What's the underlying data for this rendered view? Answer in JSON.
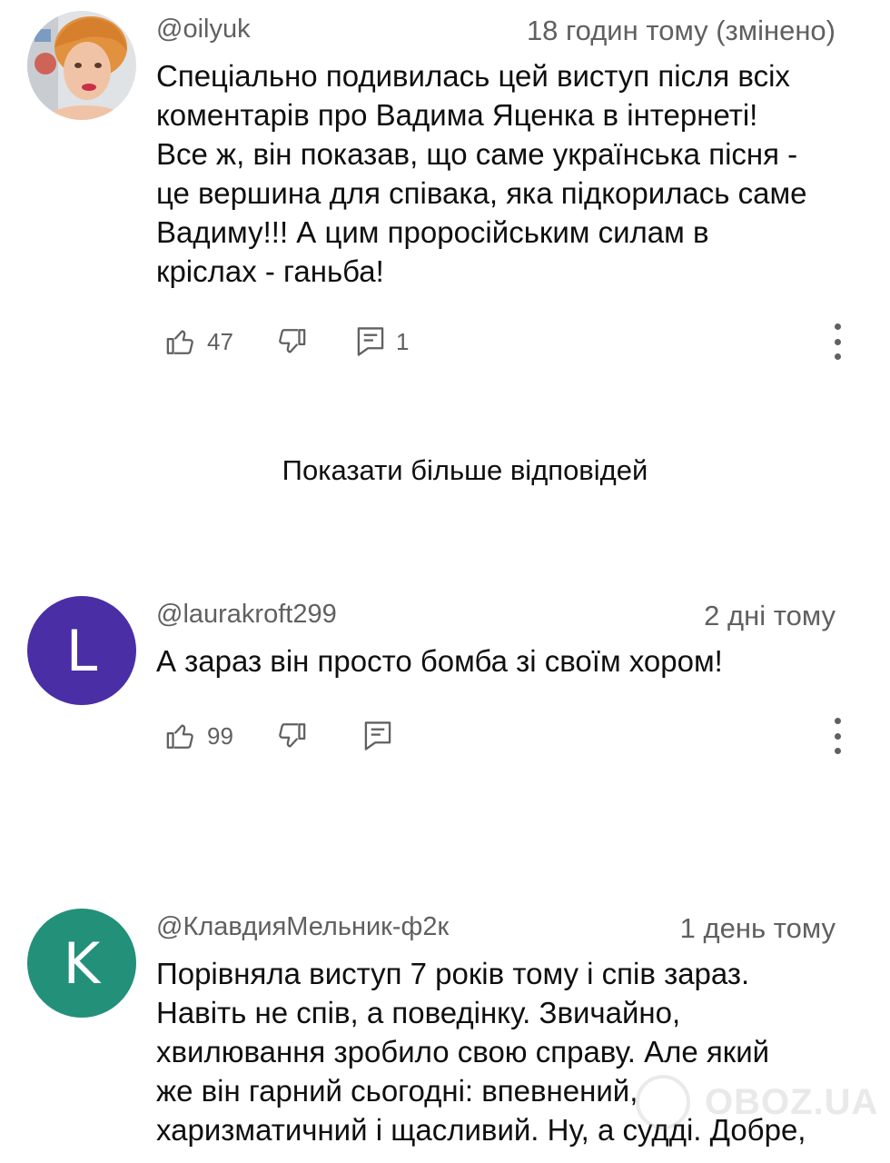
{
  "comments": [
    {
      "author": "@oilyuk",
      "time": "18 годин тому (змінено)",
      "avatar_type": "photo",
      "lines": [
        "Спеціально подивилась цей виступ після всіх",
        "коментарів про Вадима Яценка в інтернеті!",
        "Все ж, він показав, що саме українська пісня -",
        "це вершина для співака, яка підкорилась саме",
        "Вадиму!!! А цим проросійським силам в",
        "кріслах - ганьба!"
      ],
      "likes": "47",
      "replies": "1"
    },
    {
      "author": "@laurakroft299",
      "time": "2 дні тому",
      "avatar_letter": "L",
      "avatar_color": "#4a2ea6",
      "lines": [
        "А зараз він просто бомба зі своїм хором!"
      ],
      "likes": "99",
      "replies": ""
    },
    {
      "author": "@КлавдияМельник-ф2к",
      "time": "1 день тому",
      "avatar_letter": "K",
      "avatar_color": "#23907a",
      "lines": [
        "Порівняла виступ 7 років тому і спів зараз.",
        "Навіть не спів, а поведінку. Звичайно,",
        "хвилювання зробило свою справу. Але який",
        "же він гарний сьогодні: впевнений,",
        "харизматичний і щасливий. Ну, а судді. Добре,"
      ]
    }
  ],
  "show_more_replies": "Показати більше відповідей",
  "watermark": "OBOZ.UA",
  "icons": {
    "like": "thumb-up-icon",
    "dislike": "thumb-down-icon",
    "reply": "reply-comment-icon",
    "more": "more-vert-icon"
  }
}
